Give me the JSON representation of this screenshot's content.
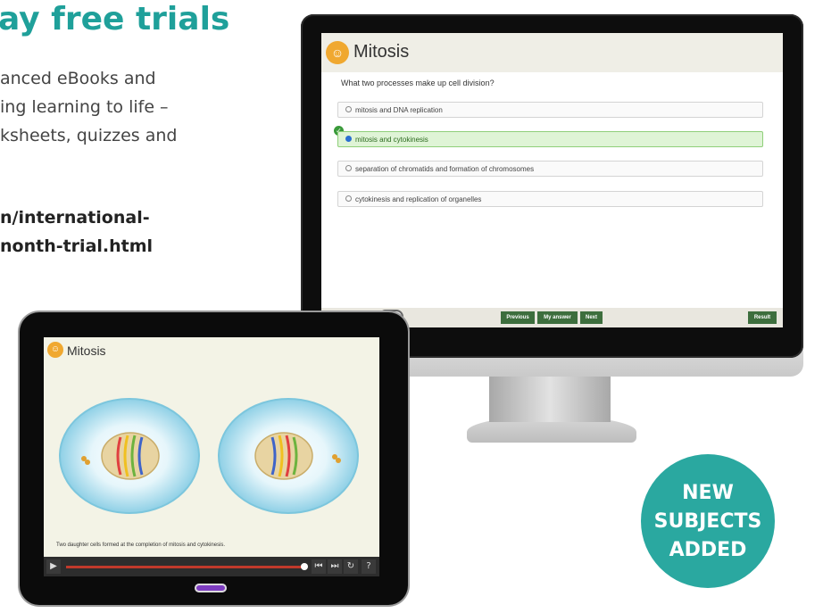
{
  "promo": {
    "title": "ay free trials",
    "body_lines": [
      "anced eBooks and",
      "ing learning to life –",
      "ksheets, quizzes and"
    ],
    "link_lines": [
      "n/international-",
      "nonth-trial.html"
    ],
    "accent_color": "#1fa09a"
  },
  "quiz": {
    "title": "Mitosis",
    "question": "What two processes make up cell division?",
    "options": [
      {
        "label": "mitosis and DNA replication",
        "selected": false
      },
      {
        "label": "mitosis and cytokinesis",
        "selected": true
      },
      {
        "label": "separation of chromatids and formation of chromosomes",
        "selected": false
      },
      {
        "label": "cytokinesis and replication of organelles",
        "selected": false
      }
    ],
    "buttons": {
      "previous": "Previous",
      "my_answer": "My answer",
      "next": "Next",
      "result": "Result"
    }
  },
  "animation": {
    "title": "Mitosis",
    "caption": "Two daughter cells formed at the completion of mitosis and cytokinesis.",
    "progress": 0.92,
    "help_label": "?"
  },
  "badge": {
    "lines": [
      "NEW",
      "SUBJECTS",
      "ADDED"
    ],
    "color": "#2aa8a0"
  },
  "icons": [
    "logo-icon",
    "check-icon",
    "play-icon",
    "skip-back-icon",
    "skip-forward-icon",
    "replay-icon",
    "help-icon"
  ]
}
